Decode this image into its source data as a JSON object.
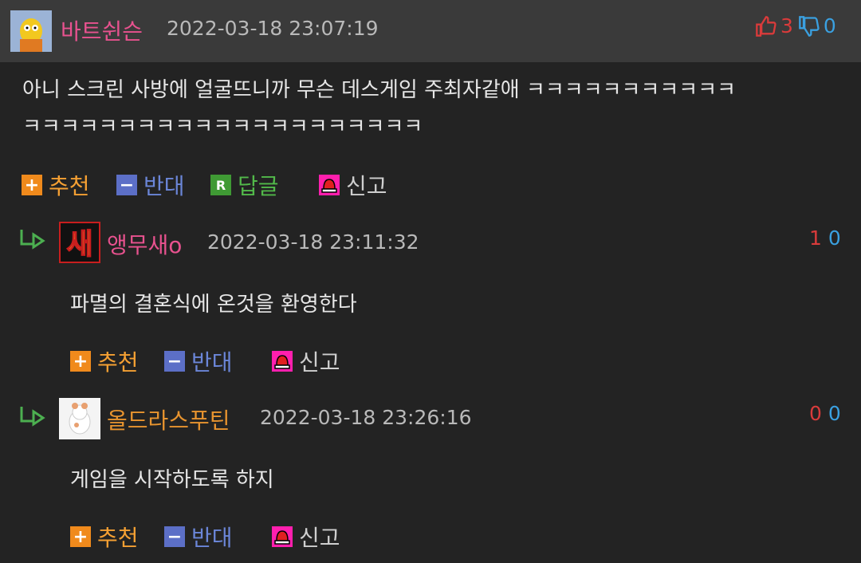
{
  "post": {
    "nickname": "바트쉰슨",
    "timestamp": "2022-03-18 23:07:19",
    "upvotes": "3",
    "downvotes": "0",
    "body_line1": "아니 스크린 사방에 얼굴뜨니까 무슨 데스게임 주최자같애 ㅋㅋㅋㅋㅋㅋㅋㅋㅋㅋㅋ",
    "body_line2": "ㅋㅋㅋㅋㅋㅋㅋㅋㅋㅋㅋㅋㅋㅋㅋㅋㅋㅋㅋㅋㅋ",
    "actions": {
      "upvote": "추천",
      "downvote": "반대",
      "reply": "답글",
      "report": "신고",
      "reply_icon_letter": "R"
    }
  },
  "replies": [
    {
      "nickname": "앵무새o",
      "avatar_text": "새",
      "timestamp": "2022-03-18 23:11:32",
      "upvotes": "1",
      "downvotes": "0",
      "body": "파멸의 결혼식에 온것을 환영한다",
      "actions": {
        "upvote": "추천",
        "downvote": "반대",
        "report": "신고"
      }
    },
    {
      "nickname": "올드라스푸틴",
      "timestamp": "2022-03-18 23:26:16",
      "upvotes": "0",
      "downvotes": "0",
      "body": "게임을 시작하도록 하지",
      "actions": {
        "upvote": "추천",
        "downvote": "반대",
        "report": "신고"
      }
    }
  ]
}
